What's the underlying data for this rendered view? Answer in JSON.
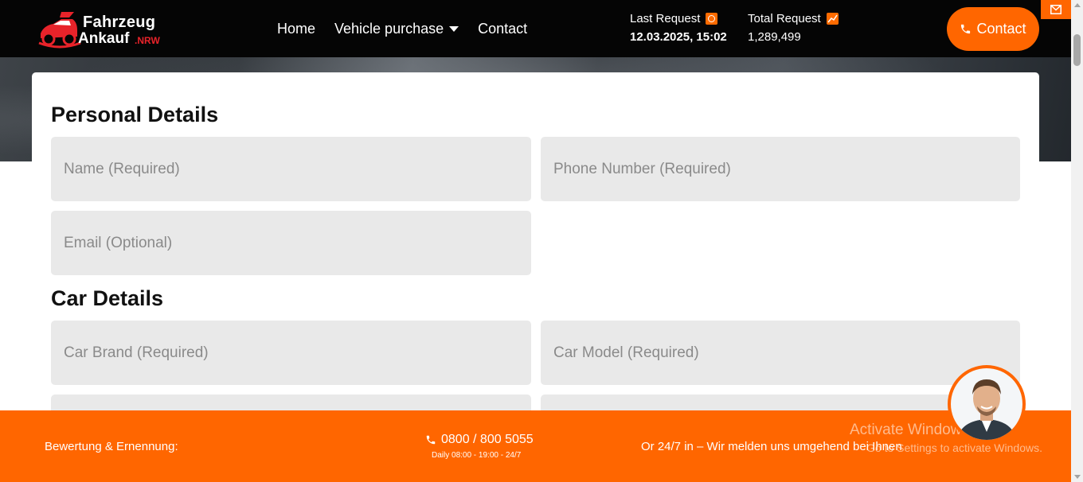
{
  "header": {
    "logo_line1": "Fahrzeug",
    "logo_line2": "Ankauf",
    "logo_suffix": ".NRW",
    "nav": {
      "home": "Home",
      "vehicle_purchase": "Vehicle purchase",
      "contact": "Contact"
    },
    "last_request": {
      "label": "Last Request",
      "value": "12.03.2025, 15:02",
      "icon": "clock-icon"
    },
    "total_request": {
      "label": "Total Request",
      "value": "1,289,499",
      "icon": "trend-icon"
    },
    "contact_button": "Contact"
  },
  "form": {
    "personal_title": "Personal Details",
    "name_placeholder": "Name (Required)",
    "phone_placeholder": "Phone Number (Required)",
    "email_placeholder": "Email (Optional)",
    "car_title": "Car Details",
    "brand_placeholder": "Car Brand (Required)",
    "model_placeholder": "Car Model (Required)"
  },
  "footer": {
    "left_text": "Bewertung & Ernennung:",
    "phone": "0800 / 800 5055",
    "hours": "Daily 08:00 - 19:00 - 24/7",
    "right_text": "Or 24/7 in – Wir melden uns umgehend bei Ihnen"
  },
  "watermark": {
    "line1": "Activate Windows",
    "line2": "Go to Settings to activate Windows."
  },
  "colors": {
    "accent": "#ff6600",
    "header_bg": "#050505",
    "field_bg": "#e9e9e9",
    "logo_red": "#e8232a"
  }
}
